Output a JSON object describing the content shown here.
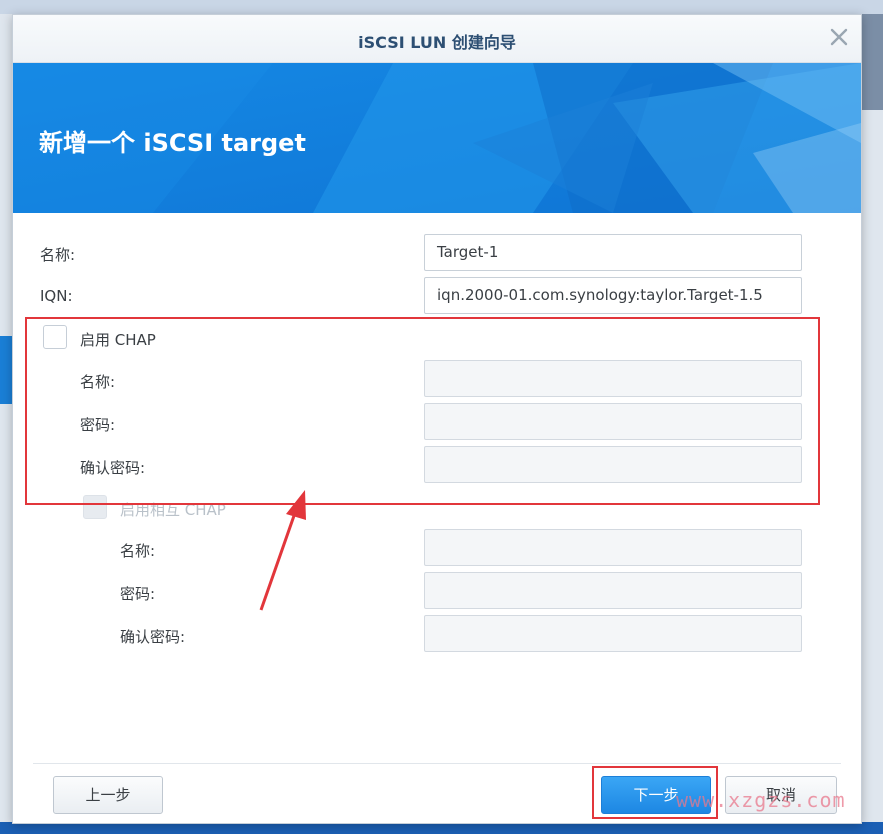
{
  "dialog": {
    "title": "iSCSI LUN 创建向导",
    "banner_title": "新增一个 iSCSI target"
  },
  "form": {
    "name_label": "名称:",
    "name_value": "Target-1",
    "iqn_label": "IQN:",
    "iqn_value": "iqn.2000-01.com.synology:taylor.Target-1.5",
    "chap": {
      "enable_label": "启用 CHAP",
      "checked": false,
      "name_label": "名称:",
      "password_label": "密码:",
      "confirm_label": "确认密码:"
    },
    "mutual_chap": {
      "enable_label": "启用相互 CHAP",
      "checked": false,
      "disabled": true,
      "name_label": "名称:",
      "password_label": "密码:",
      "confirm_label": "确认密码:"
    }
  },
  "footer": {
    "back_label": "上一步",
    "next_label": "下一步",
    "cancel_label": "取消"
  },
  "watermark": "www.xzgzs.com",
  "colors": {
    "accent": "#1d87e3",
    "annotation_red": "#e2363b"
  }
}
